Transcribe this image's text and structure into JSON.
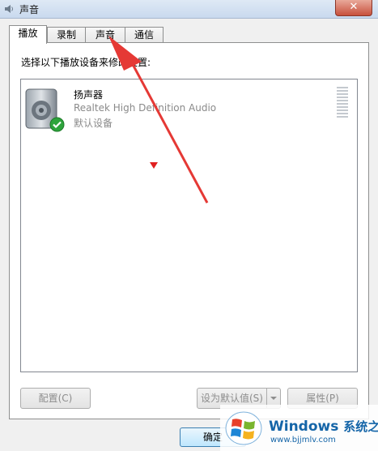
{
  "window": {
    "title": "声音",
    "close_symbol": "✕"
  },
  "tabs": [
    "播放",
    "录制",
    "声音",
    "通信"
  ],
  "instruction": "选择以下播放设备来修改设置:",
  "device": {
    "name": "扬声器",
    "description": "Realtek High Definition Audio",
    "status": "默认设备",
    "icon": "speaker-icon",
    "status_icon": "green-check-icon"
  },
  "buttons": {
    "configure": "配置(C)",
    "set_default": "设为默认值(S)",
    "properties": "属性(P)",
    "ok": "确定"
  },
  "watermark": {
    "brand": "Windows",
    "subtitle": "系统之家",
    "url": "www.bjjmlv.com"
  },
  "annotation_color": "#e53935"
}
